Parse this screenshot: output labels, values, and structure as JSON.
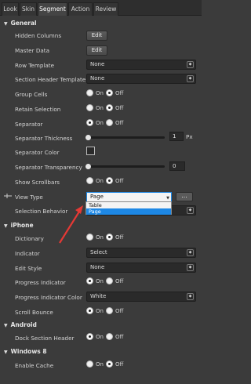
{
  "tabs": [
    "Look",
    "Skin",
    "Segment",
    "Action",
    "Review"
  ],
  "sections": {
    "general": "General",
    "iphone": "iPhone",
    "android": "Android",
    "windows8": "Windows 8"
  },
  "general": {
    "hidden_columns": {
      "label": "Hidden Columns",
      "button": "Edit"
    },
    "master_data": {
      "label": "Master Data",
      "button": "Edit"
    },
    "row_template": {
      "label": "Row Template",
      "value": "None"
    },
    "section_header_template": {
      "label": "Section Header Template",
      "value": "None"
    },
    "group_cells": {
      "label": "Group Cells",
      "on": "On",
      "off": "Off"
    },
    "retain_selection": {
      "label": "Retain Selection",
      "on": "On",
      "off": "Off"
    },
    "separator": {
      "label": "Separator",
      "on": "On",
      "off": "Off"
    },
    "separator_thickness": {
      "label": "Separator Thickness",
      "value": "1",
      "unit": "Px",
      "level": 0
    },
    "separator_color": {
      "label": "Separator Color"
    },
    "separator_transparency": {
      "label": "Separator Transparency",
      "value": "0",
      "level": 0
    },
    "show_scrollbars": {
      "label": "Show Scrollbars",
      "on": "On",
      "off": "Off"
    },
    "view_type": {
      "label": "View Type",
      "value": "Page",
      "ellipsis": "...",
      "options": [
        "Table",
        "Page"
      ]
    },
    "selection_behavior": {
      "label": "Selection Behavior"
    }
  },
  "iphone": {
    "dictionary": {
      "label": "Dictionary",
      "on": "On",
      "off": "Off"
    },
    "indicator": {
      "label": "Indicator",
      "value": "Select"
    },
    "edit_style": {
      "label": "Edit Style",
      "value": "None"
    },
    "progress_indicator": {
      "label": "Progress Indicator",
      "on": "On",
      "off": "Off"
    },
    "progress_indicator_color": {
      "label": "Progress Indicator Color",
      "value": "White"
    },
    "scroll_bounce": {
      "label": "Scroll Bounce",
      "on": "On",
      "off": "Off"
    }
  },
  "android": {
    "dock_section_header": {
      "label": "Dock Section Header",
      "on": "On",
      "off": "Off"
    }
  },
  "windows8": {
    "enable_cache": {
      "label": "Enable Cache",
      "on": "On",
      "off": "Off"
    }
  },
  "colors": {
    "accent": "#1e88e5",
    "annotation": "#e53935",
    "panel": "#3b3b3b"
  }
}
